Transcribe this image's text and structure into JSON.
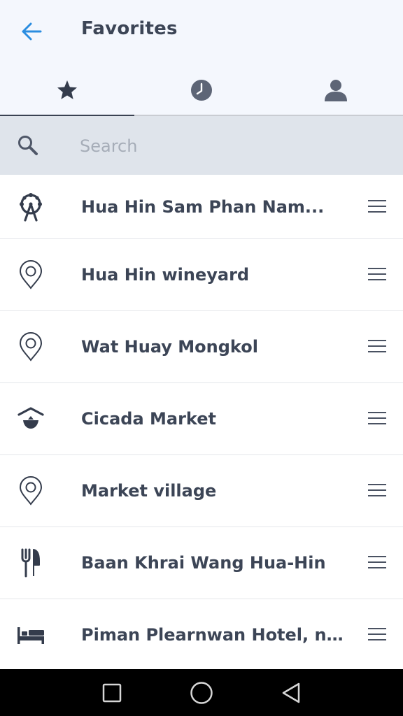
{
  "header": {
    "title": "Favorites",
    "back_icon": "arrow-left-icon",
    "accent_color": "#2b8de0"
  },
  "tabs": [
    {
      "name": "favorites",
      "icon": "star-icon",
      "active": true
    },
    {
      "name": "history",
      "icon": "clock-icon",
      "active": false
    },
    {
      "name": "profile",
      "icon": "person-icon",
      "active": false
    }
  ],
  "search": {
    "placeholder": "Search",
    "value": ""
  },
  "favorites": [
    {
      "label": "Hua Hin Sam Phan Nam...",
      "icon": "ferris-wheel-icon"
    },
    {
      "label": "Hua Hin wineyard",
      "icon": "location-pin-icon"
    },
    {
      "label": "Wat Huay Mongkol",
      "icon": "location-pin-icon"
    },
    {
      "label": "Cicada Market",
      "icon": "market-stall-icon"
    },
    {
      "label": "Market village",
      "icon": "location-pin-icon"
    },
    {
      "label": "Baan Khrai Wang Hua-Hin",
      "icon": "fork-knife-icon"
    },
    {
      "label": "Piman Plearnwan Hotel, near...",
      "icon": "bed-icon"
    }
  ],
  "system_nav": [
    {
      "name": "recent-apps",
      "icon": "square-icon"
    },
    {
      "name": "home",
      "icon": "circle-icon"
    },
    {
      "name": "back",
      "icon": "triangle-back-icon"
    }
  ]
}
